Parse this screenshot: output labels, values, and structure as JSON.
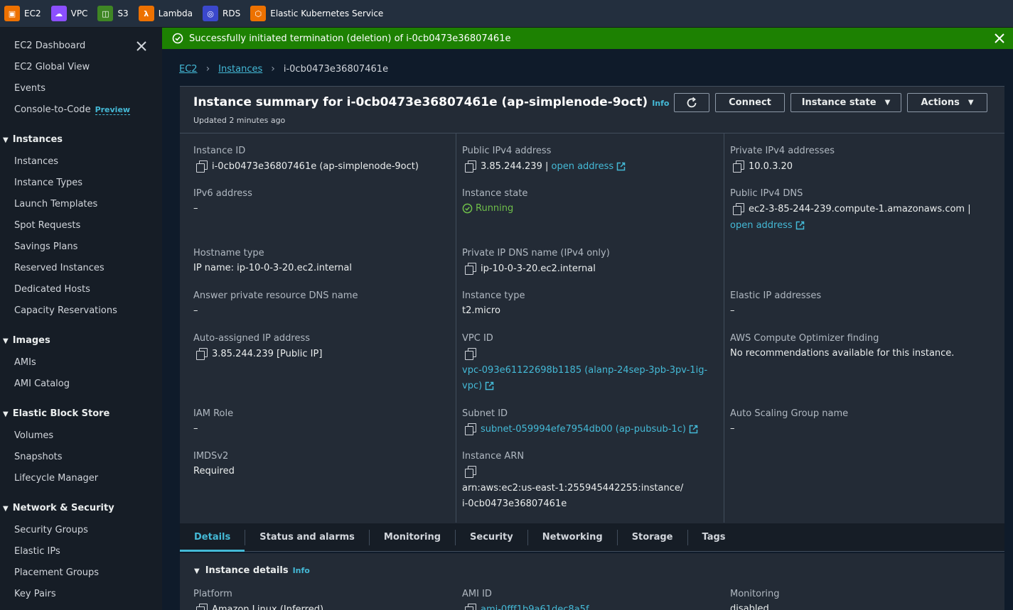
{
  "topbar": {
    "services": [
      {
        "name": "EC2",
        "color": "#ed7100"
      },
      {
        "name": "VPC",
        "color": "#8c4fff"
      },
      {
        "name": "S3",
        "color": "#3f8624"
      },
      {
        "name": "Lambda",
        "color": "#ed7100"
      },
      {
        "name": "RDS",
        "color": "#3b48cc"
      },
      {
        "name": "Elastic Kubernetes Service",
        "color": "#ed7100"
      }
    ]
  },
  "sidebar": {
    "items": {
      "ec2_dashboard": "EC2 Dashboard",
      "ec2_global_view": "EC2 Global View",
      "events": "Events",
      "console_to_code": "Console-to-Code",
      "preview": "Preview",
      "sec_instances": "Instances",
      "instances": "Instances",
      "instance_types": "Instance Types",
      "launch_templates": "Launch Templates",
      "spot_requests": "Spot Requests",
      "savings_plans": "Savings Plans",
      "reserved_instances": "Reserved Instances",
      "dedicated_hosts": "Dedicated Hosts",
      "capacity_reservations": "Capacity Reservations",
      "sec_images": "Images",
      "amis": "AMIs",
      "ami_catalog": "AMI Catalog",
      "sec_ebs": "Elastic Block Store",
      "volumes": "Volumes",
      "snapshots": "Snapshots",
      "lifecycle_manager": "Lifecycle Manager",
      "sec_network": "Network & Security",
      "security_groups": "Security Groups",
      "elastic_ips": "Elastic IPs",
      "placement_groups": "Placement Groups",
      "key_pairs": "Key Pairs"
    }
  },
  "flash": {
    "message": "Successfully initiated termination (deletion) of i-0cb0473e36807461e"
  },
  "breadcrumb": {
    "ec2": "EC2",
    "instances": "Instances",
    "current": "i-0cb0473e36807461e"
  },
  "summary": {
    "title": "Instance summary for i-0cb0473e36807461e (ap-simplenode-9oct)",
    "info": "Info",
    "updated": "Updated 2 minutes ago",
    "buttons": {
      "connect": "Connect",
      "instance_state": "Instance state",
      "actions": "Actions"
    }
  },
  "fields": {
    "instance_id_label": "Instance ID",
    "instance_id": "i-0cb0473e36807461e (ap-simplenode-9oct)",
    "ipv6_label": "IPv6 address",
    "ipv6": "–",
    "hostname_type_label": "Hostname type",
    "hostname_type": "IP name: ip-10-0-3-20.ec2.internal",
    "answer_dns_label": "Answer private resource DNS name",
    "answer_dns": "–",
    "auto_ip_label": "Auto-assigned IP address",
    "auto_ip": "3.85.244.239 [Public IP]",
    "iam_role_label": "IAM Role",
    "iam_role": "–",
    "imdsv2_label": "IMDSv2",
    "imdsv2": "Required",
    "public_ipv4_label": "Public IPv4 address",
    "public_ipv4": "3.85.244.239 |",
    "open_address": "open address",
    "instance_state_label": "Instance state",
    "instance_state": "Running",
    "private_dns_label": "Private IP DNS name (IPv4 only)",
    "private_dns": "ip-10-0-3-20.ec2.internal",
    "instance_type_label": "Instance type",
    "instance_type": "t2.micro",
    "vpc_id_label": "VPC ID",
    "vpc_id_line1": "vpc-093e61122698b1185 (alanp-24sep-3pb-3pv-1ig-",
    "vpc_id_line2": "vpc)",
    "subnet_id_label": "Subnet ID",
    "subnet_id": "subnet-059994efe7954db00 (ap-pubsub-1c)",
    "arn_label": "Instance ARN",
    "arn_line1": "arn:aws:ec2:us-east-1:255945442255:instance/",
    "arn_line2": "i-0cb0473e36807461e",
    "private_ipv4_label": "Private IPv4 addresses",
    "private_ipv4": "10.0.3.20",
    "public_dns_label": "Public IPv4 DNS",
    "public_dns": "ec2-3-85-244-239.compute-1.amazonaws.com |",
    "elastic_ip_label": "Elastic IP addresses",
    "elastic_ip": "–",
    "optimizer_label": "AWS Compute Optimizer finding",
    "optimizer": "No recommendations available for this instance.",
    "asg_label": "Auto Scaling Group name",
    "asg": "–"
  },
  "tabs": [
    "Details",
    "Status and alarms",
    "Monitoring",
    "Security",
    "Networking",
    "Storage",
    "Tags"
  ],
  "details": {
    "title": "Instance details",
    "info": "Info",
    "platform_label": "Platform",
    "platform": "Amazon Linux (Inferred)",
    "ami_id_label": "AMI ID",
    "ami_id": "ami-0fff1b9a61dec8a5f",
    "monitoring_label": "Monitoring",
    "monitoring": "disabled"
  }
}
